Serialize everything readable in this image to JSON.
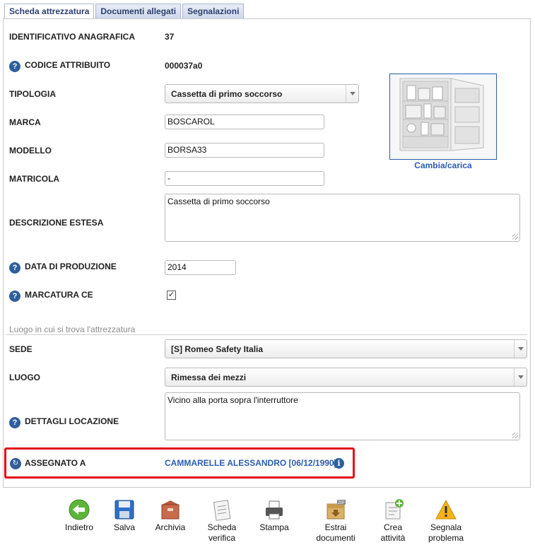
{
  "tabs": [
    {
      "label": "Scheda attrezzatura",
      "active": true
    },
    {
      "label": "Documenti allegati",
      "active": false
    },
    {
      "label": "Segnalazioni",
      "active": false
    }
  ],
  "fields": {
    "identificativo": {
      "label": "IDENTIFICATIVO ANAGRAFICA",
      "value": "37"
    },
    "codice": {
      "label": "CODICE ATTRIBUITO",
      "value": "000037a0"
    },
    "tipologia": {
      "label": "TIPOLOGIA",
      "value": "Cassetta di primo soccorso"
    },
    "marca": {
      "label": "MARCA",
      "value": "BOSCAROL"
    },
    "modello": {
      "label": "MODELLO",
      "value": "BORSA33"
    },
    "matricola": {
      "label": "MATRICOLA",
      "value": "-"
    },
    "descrizione": {
      "label": "DESCRIZIONE ESTESA",
      "value": "Cassetta di primo soccorso"
    },
    "data_produzione": {
      "label": "DATA DI PRODUZIONE",
      "value": "2014"
    },
    "marcatura_ce": {
      "label": "MARCATURA CE",
      "checked": true
    }
  },
  "photo": {
    "link": "Cambia/carica"
  },
  "location": {
    "section_title": "Luogo in cui si trova l'attrezzatura",
    "sede": {
      "label": "SEDE",
      "value": "[S] Romeo Safety Italia"
    },
    "luogo": {
      "label": "LUOGO",
      "value": "Rimessa dei mezzi"
    },
    "dettagli": {
      "label": "DETTAGLI LOCAZIONE",
      "value": "Vicino alla porta sopra l'interruttore"
    }
  },
  "assigned": {
    "label": "ASSEGNATO A",
    "value": "CAMMARELLE ALESSANDRO [06/12/1990]"
  },
  "toolbar": {
    "indietro": "Indietro",
    "salva": "Salva",
    "archivia": "Archivia",
    "scheda_1": "Scheda",
    "scheda_2": "verifica",
    "stampa": "Stampa",
    "estrai_1": "Estrai",
    "estrai_2": "documenti",
    "crea_1": "Crea",
    "crea_2": "attività",
    "segnala_1": "Segnala",
    "segnala_2": "problema",
    "zip_badge": "ZIP"
  },
  "colors": {
    "accent": "#2a5db0",
    "highlight_border": "#e20f14",
    "help_icon": "#2f5f9c"
  }
}
